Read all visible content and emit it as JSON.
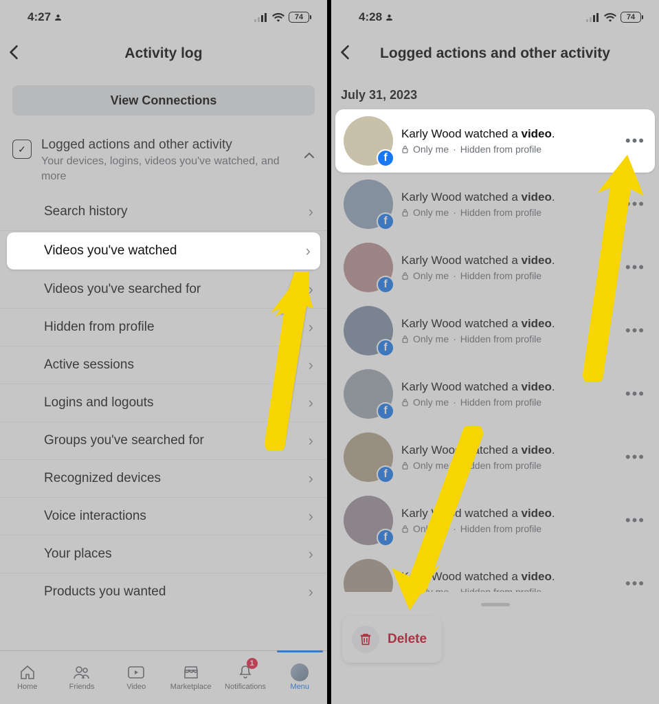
{
  "left": {
    "status": {
      "time": "4:27",
      "battery": "74"
    },
    "header": {
      "title": "Activity log"
    },
    "view_connections": "View Connections",
    "section": {
      "title": "Logged actions and other activity",
      "subtitle": "Your devices, logins, videos you've watched, and more"
    },
    "items": [
      "Search history",
      "Videos you've watched",
      "Videos you've searched for",
      "Hidden from profile",
      "Active sessions",
      "Logins and logouts",
      "Groups you've searched for",
      "Recognized devices",
      "Voice interactions",
      "Your places",
      "Products you wanted"
    ],
    "tabs": {
      "home": "Home",
      "friends": "Friends",
      "video": "Video",
      "marketplace": "Marketplace",
      "notifications": "Notifications",
      "menu": "Menu",
      "badge": "1"
    }
  },
  "right": {
    "status": {
      "time": "4:28",
      "battery": "74"
    },
    "header": {
      "title": "Logged actions and other activity"
    },
    "date": "July 31, 2023",
    "entry": {
      "actor": "Karly Wood",
      "verb_pre": " watched a ",
      "object": "video",
      "suffix": ".",
      "privacy": "Only me",
      "dot": "·",
      "meta": "Hidden from profile"
    },
    "delete": "Delete"
  }
}
